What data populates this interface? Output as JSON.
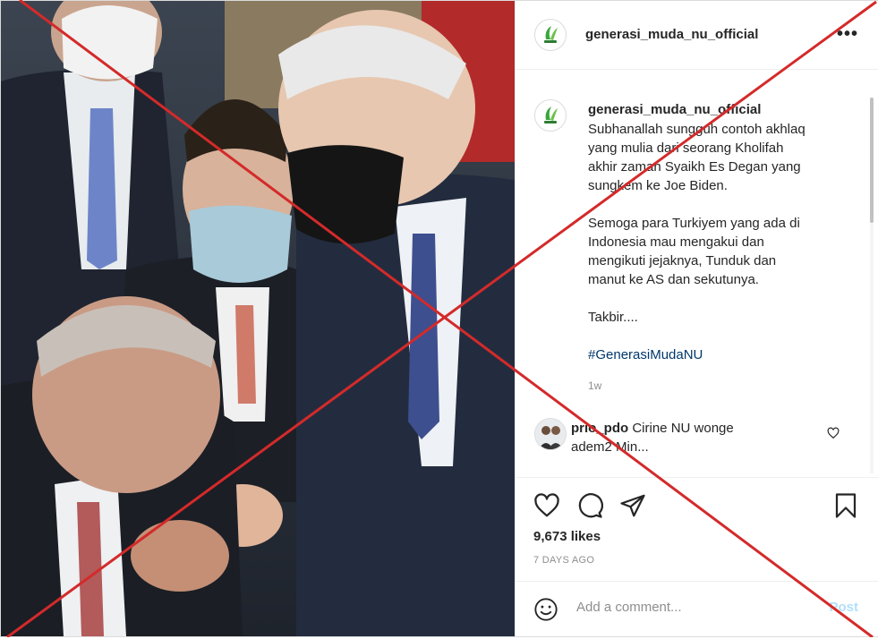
{
  "post": {
    "username": "generasi_muda_nu_official",
    "more_glyph": "•••",
    "caption_lines_1": [
      "Subhanallah sungguh contoh akhlaq",
      "yang mulia dari seorang Kholifah",
      "akhir zaman Syaikh Es Degan yang",
      "sungkem ke Joe Biden."
    ],
    "caption_lines_2": [
      "Semoga para Turkiyem yang ada di",
      "Indonesia mau mengakui dan",
      "mengikuti jejaknya, Tunduk dan",
      "manut ke AS dan sekutunya."
    ],
    "caption_line_3": "Takbir....",
    "hashtag": "#GenerasiMudaNU",
    "caption_age": "1w"
  },
  "comment": {
    "username": "prio_pdo",
    "text_line1": "Cirine NU wonge",
    "text_line2": "adem2 Min..."
  },
  "engagement": {
    "likes": "9,673 likes",
    "date": "7 DAYS AGO"
  },
  "composer": {
    "placeholder": "Add a comment...",
    "post_label": "Post"
  },
  "colors": {
    "cross": "#d42a2a",
    "hashtag": "#00376b",
    "muted": "#8e8e8e"
  }
}
